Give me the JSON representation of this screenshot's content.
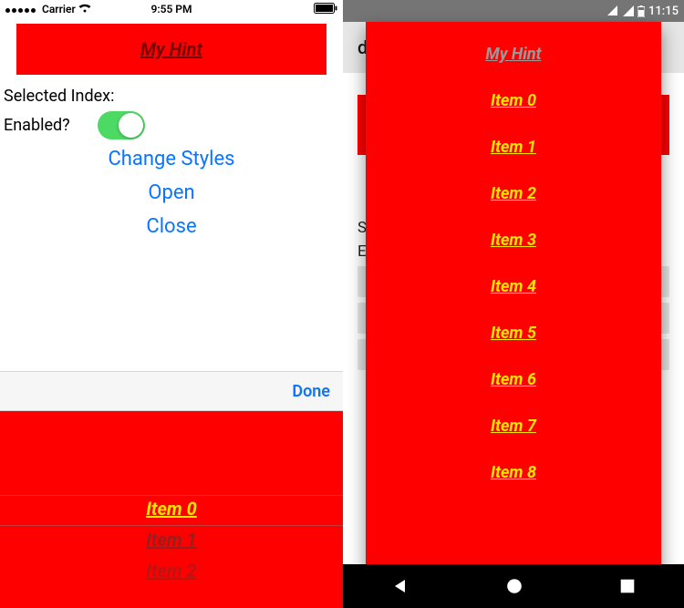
{
  "ios": {
    "status": {
      "carrier": "Carrier",
      "time": "9:55 PM"
    },
    "hint": "My Hint",
    "labels": {
      "selected_index": "Selected Index:",
      "enabled": "Enabled?"
    },
    "switch_on": true,
    "actions": {
      "change_styles": "Change Styles",
      "open": "Open",
      "close": "Close"
    },
    "done": "Done",
    "picker": {
      "items": [
        "Item 0",
        "Item 1",
        "Item 2"
      ]
    }
  },
  "android": {
    "status": {
      "time": "11:15"
    },
    "header": "demo",
    "hint": "My Hint",
    "labels": {
      "selected_prefix": "Sele",
      "enabled_prefix": "Enal"
    },
    "items": [
      "Item 0",
      "Item 1",
      "Item 2",
      "Item 3",
      "Item 4",
      "Item 5",
      "Item 6",
      "Item 7",
      "Item 8"
    ]
  },
  "colors": {
    "red": "#f00",
    "yellow": "#ffe400",
    "ios_blue": "#0b75ff",
    "switch_green": "#4cd964"
  }
}
